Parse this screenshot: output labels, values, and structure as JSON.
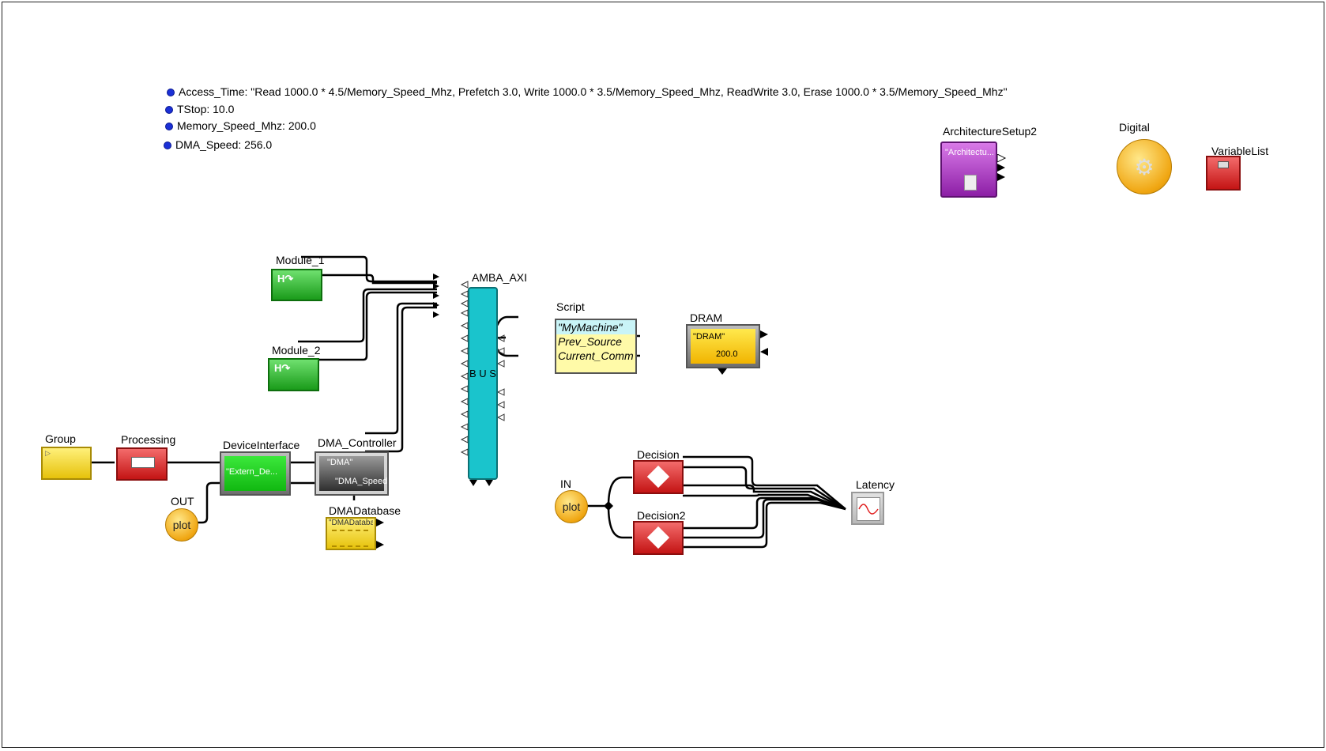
{
  "parameters": [
    "Access_Time: \"Read 1000.0 * 4.5/Memory_Speed_Mhz, Prefetch 3.0, Write 1000.0 * 3.5/Memory_Speed_Mhz, ReadWrite 3.0, Erase 1000.0 * 3.5/Memory_Speed_Mhz\"",
    "TStop: 10.0",
    "Memory_Speed_Mhz: 200.0",
    "DMA_Speed: 256.0"
  ],
  "blocks": {
    "architecture_setup": {
      "title": "ArchitectureSetup2",
      "inner": "\"Architectu..."
    },
    "digital": {
      "title": "Digital"
    },
    "variable_list": {
      "title": "VariableList"
    },
    "module_1": {
      "title": "Module_1"
    },
    "module_2": {
      "title": "Module_2"
    },
    "amba_axi": {
      "title": "AMBA_AXI",
      "bus_label": "B U S"
    },
    "script": {
      "title": "Script",
      "lines": [
        "\"MyMachine\"",
        "Prev_Source",
        "Current_Comm"
      ]
    },
    "dram": {
      "title": "DRAM",
      "name": "\"DRAM\"",
      "value": "200.0"
    },
    "group": {
      "title": "Group"
    },
    "processing": {
      "title": "Processing"
    },
    "device_interface": {
      "title": "DeviceInterface",
      "inner": "\"Extern_De..."
    },
    "dma_controller": {
      "title": "DMA_Controller",
      "inner_top": "\"DMA\"",
      "inner_bottom": "\"DMA_Speed"
    },
    "dma_database": {
      "title": "DMADatabase",
      "inner": "\"DMADataba..."
    },
    "out": {
      "title": "OUT",
      "label": "plot"
    },
    "in": {
      "title": "IN",
      "label": "plot"
    },
    "decision": {
      "title": "Decision"
    },
    "decision2": {
      "title": "Decision2"
    },
    "latency": {
      "title": "Latency"
    }
  },
  "colors": {
    "bus": "#1ac4cc",
    "wire": "#000000",
    "param_bullet": "#1b30d6"
  }
}
